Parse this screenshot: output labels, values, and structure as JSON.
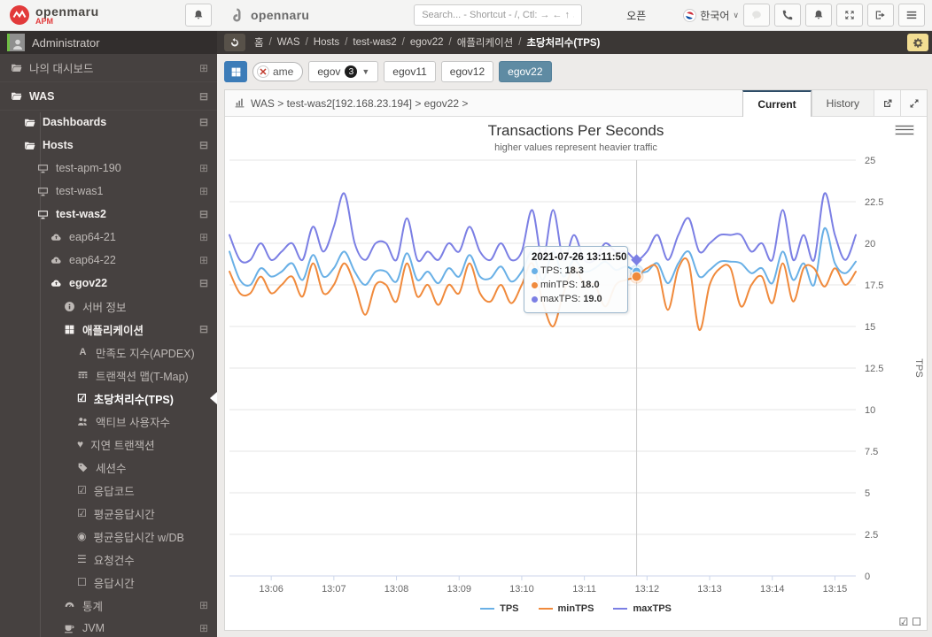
{
  "topbar": {
    "logo": {
      "brand": "openmaru",
      "sub": "APM"
    },
    "partner_logo": "opennaru",
    "search_placeholder": "Search... - Shortcut - /, Ctl: → ← ↑ ↓",
    "open_label": "오픈",
    "language": "한국어"
  },
  "userbar": {
    "username": "Administrator"
  },
  "breadcrumb": {
    "items": [
      "홈",
      "WAS",
      "Hosts",
      "test-was2",
      "egov22",
      "애플리케이션",
      "초당처리수(TPS)"
    ]
  },
  "filterbar": {
    "chip_label": "ame",
    "group": {
      "label": "egov",
      "count": "3"
    },
    "instances": [
      {
        "label": "egov11",
        "selected": false
      },
      {
        "label": "egov12",
        "selected": false
      },
      {
        "label": "egov22",
        "selected": true
      }
    ]
  },
  "sidebar": {
    "items": [
      {
        "id": "my-dashboard",
        "label": "나의 대시보드",
        "icon": "folder",
        "depth": 0,
        "d0": true,
        "expander": "expand",
        "bold": false,
        "active": false
      },
      {
        "id": "was",
        "label": "WAS",
        "icon": "folder",
        "depth": 0,
        "d0": true,
        "expander": "collapse",
        "bold": true,
        "active": false
      },
      {
        "id": "dashboards",
        "label": "Dashboards",
        "icon": "folder",
        "depth": 1,
        "expander": "collapse",
        "bold": true,
        "active": false
      },
      {
        "id": "hosts",
        "label": "Hosts",
        "icon": "folder",
        "depth": 1,
        "expander": "collapse",
        "bold": true,
        "active": false
      },
      {
        "id": "test-apm-190",
        "label": "test-apm-190",
        "icon": "monitor",
        "depth": 2,
        "expander": "expand",
        "bold": false,
        "active": false
      },
      {
        "id": "test-was1",
        "label": "test-was1",
        "icon": "monitor",
        "depth": 2,
        "expander": "expand",
        "bold": false,
        "active": false
      },
      {
        "id": "test-was2",
        "label": "test-was2",
        "icon": "monitor",
        "depth": 2,
        "expander": "collapse",
        "bold": true,
        "active": false
      },
      {
        "id": "eap64-21",
        "label": "eap64-21",
        "icon": "cloud",
        "depth": 3,
        "expander": "expand",
        "bold": false,
        "active": false
      },
      {
        "id": "eap64-22",
        "label": "eap64-22",
        "icon": "cloud",
        "depth": 3,
        "expander": "expand",
        "bold": false,
        "active": false
      },
      {
        "id": "egov22",
        "label": "egov22",
        "icon": "cloud",
        "depth": 3,
        "expander": "collapse",
        "bold": true,
        "active": false
      },
      {
        "id": "server-info",
        "label": "서버 정보",
        "icon": "info",
        "depth": 4,
        "expander": null,
        "bold": false,
        "active": false
      },
      {
        "id": "application",
        "label": "애플리케이션",
        "icon": "grid",
        "depth": 4,
        "expander": "collapse",
        "bold": true,
        "active": false
      },
      {
        "id": "apdex",
        "label": "만족도 지수(APDEX)",
        "icon": "apdex",
        "depth": 5,
        "expander": null,
        "bold": false,
        "active": false
      },
      {
        "id": "tmap",
        "label": "트랜잭션 맵(T-Map)",
        "icon": "table",
        "depth": 5,
        "expander": null,
        "bold": false,
        "active": false
      },
      {
        "id": "tps",
        "label": "초당처리수(TPS)",
        "icon": "check-square",
        "depth": 5,
        "expander": null,
        "bold": true,
        "active": true
      },
      {
        "id": "active-users",
        "label": "액티브 사용자수",
        "icon": "users",
        "depth": 5,
        "expander": null,
        "bold": false,
        "active": false
      },
      {
        "id": "delayed-tx",
        "label": "지연 트랜잭션",
        "icon": "heart",
        "depth": 5,
        "expander": null,
        "bold": false,
        "active": false
      },
      {
        "id": "sessions",
        "label": "세션수",
        "icon": "tag",
        "depth": 5,
        "expander": null,
        "bold": false,
        "active": false
      },
      {
        "id": "response-code",
        "label": "응답코드",
        "icon": "check-square",
        "depth": 5,
        "expander": null,
        "bold": false,
        "active": false
      },
      {
        "id": "avg-response",
        "label": "평균응답시간",
        "icon": "check-square",
        "depth": 5,
        "expander": null,
        "bold": false,
        "active": false
      },
      {
        "id": "avg-response-db",
        "label": "평균응답시간 w/DB",
        "icon": "dot-circle",
        "depth": 5,
        "expander": null,
        "bold": false,
        "active": false
      },
      {
        "id": "request-count",
        "label": "요청건수",
        "icon": "list",
        "depth": 5,
        "expander": null,
        "bold": false,
        "active": false
      },
      {
        "id": "response-time",
        "label": "응답시간",
        "icon": "square",
        "depth": 5,
        "expander": null,
        "bold": false,
        "active": false
      },
      {
        "id": "statistics",
        "label": "통계",
        "icon": "gauge",
        "depth": 4,
        "expander": "expand",
        "bold": false,
        "active": false
      },
      {
        "id": "jvm",
        "label": "JVM",
        "icon": "coffee",
        "depth": 4,
        "expander": "expand",
        "bold": false,
        "active": false
      }
    ]
  },
  "panel": {
    "path": "WAS > test-was2[192.168.23.194] > egov22 >",
    "tabs": [
      {
        "label": "Current",
        "active": true
      },
      {
        "label": "History",
        "active": false
      }
    ]
  },
  "tooltip": {
    "datetime": "2021-07-26 13:11:50",
    "rows": [
      {
        "label": "TPS",
        "value": "18.3",
        "color": "#69b0e6"
      },
      {
        "label": "minTPS",
        "value": "18.0",
        "color": "#f08a3c"
      },
      {
        "label": "maxTPS",
        "value": "19.0",
        "color": "#7b7fe4"
      }
    ]
  },
  "chart_data": {
    "type": "line",
    "title": "Transactions Per Seconds",
    "subtitle": "higher values represent heavier traffic",
    "ylabel": "TPS",
    "ylim": [
      0,
      25
    ],
    "yticks": [
      0,
      2.5,
      5,
      7.5,
      10,
      12.5,
      15,
      17.5,
      20,
      22.5,
      25
    ],
    "x_start": "13:05:20",
    "x_step_seconds": 10,
    "xticklabels": [
      "13:06",
      "13:07",
      "13:08",
      "13:09",
      "13:10",
      "13:11",
      "13:12",
      "13:13",
      "13:14",
      "13:15"
    ],
    "xtick_indices": [
      4,
      10,
      16,
      22,
      28,
      34,
      40,
      46,
      52,
      58
    ],
    "grid": true,
    "legend_position": "bottom",
    "hover_index": 39,
    "colors": {
      "TPS": "#69b0e6",
      "minTPS": "#f08a3c",
      "maxTPS": "#7b7fe4"
    },
    "series": [
      {
        "name": "TPS",
        "values": [
          19.5,
          17.8,
          17.5,
          18.5,
          18,
          18.3,
          18.8,
          17.8,
          19.3,
          18,
          18.5,
          19.5,
          18.3,
          17.5,
          18.3,
          18.3,
          17.7,
          19.4,
          17.8,
          18.3,
          17.6,
          18.5,
          18,
          19.3,
          18,
          17.9,
          18.6,
          17.7,
          18.3,
          19.5,
          17.8,
          19.5,
          18,
          19,
          18.3,
          18.5,
          18.9,
          18.4,
          18.6,
          18.3,
          18.3,
          18.8,
          17.6,
          18.8,
          19.5,
          18,
          18.4,
          18.9,
          18.9,
          18.8,
          18.2,
          18.5,
          17.6,
          19.5,
          17.8,
          18.8,
          17.5,
          20.9,
          18.8,
          18.2,
          18.9
        ]
      },
      {
        "name": "minTPS",
        "values": [
          18.3,
          17,
          17,
          18,
          17,
          17.5,
          18,
          16.8,
          18.8,
          17,
          17.5,
          18.8,
          17.5,
          15.7,
          17.5,
          17.5,
          16.5,
          18.8,
          16.8,
          17.5,
          16.3,
          17.5,
          17,
          18.8,
          17,
          16.5,
          17.5,
          16.4,
          17.5,
          18.8,
          16.5,
          15,
          17,
          18.5,
          17.5,
          17.5,
          16.2,
          17.5,
          17.8,
          18,
          18.5,
          18.5,
          16,
          18.5,
          18.8,
          14.8,
          17.5,
          18.5,
          18.5,
          16.2,
          17.5,
          18,
          16.4,
          18.8,
          16.5,
          18.5,
          18.5,
          17.4,
          18.5,
          17.5,
          18.3
        ]
      },
      {
        "name": "maxTPS",
        "values": [
          20.5,
          19,
          19,
          20,
          19,
          19.5,
          20,
          19,
          21,
          19.5,
          21,
          23,
          20,
          19,
          20,
          20,
          19,
          21.5,
          19,
          19.5,
          19,
          20,
          19.5,
          21,
          19.5,
          19,
          20,
          19,
          19.5,
          22,
          19,
          22,
          19,
          20.5,
          19,
          19,
          20,
          19.5,
          19.5,
          19,
          19.5,
          20.5,
          19,
          20.5,
          21.5,
          19.5,
          20,
          20.5,
          20.5,
          20.5,
          19.5,
          20,
          19,
          22,
          19,
          20.5,
          19,
          23,
          20.5,
          19,
          20.5
        ]
      }
    ]
  }
}
